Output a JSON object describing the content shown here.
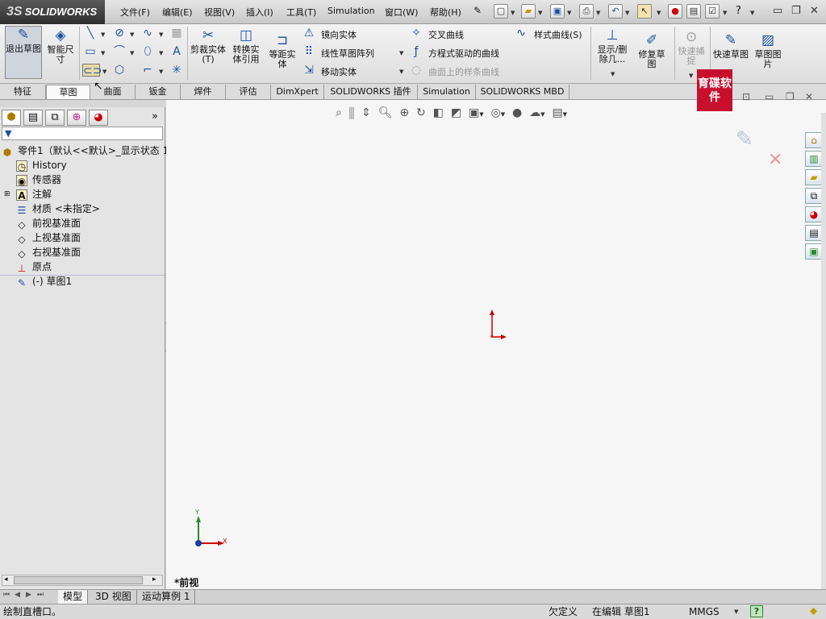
{
  "app": {
    "brand": "SOLIDWORKS"
  },
  "menu": [
    "文件(F)",
    "编辑(E)",
    "视图(V)",
    "插入(I)",
    "工具(T)",
    "Simulation",
    "窗口(W)",
    "帮助(H)"
  ],
  "ribbon": {
    "exit_sketch": "退出草图",
    "smart_dim": "智能尺寸",
    "trim": "剪裁实体(T)",
    "convert": "转换实体引用",
    "offset": "等距实体",
    "mirror": "镜向实体",
    "linear_pattern": "线性草图阵列",
    "move": "移动实体",
    "intersect": "交叉曲线",
    "equation_curve": "方程式驱动的曲线",
    "curve_on_surface": "曲面上的样条曲线",
    "style_spline": "样式曲线(S)",
    "display_delete": "显示/删除几...",
    "repair": "修复草图",
    "quick_snap": "快速捕捉",
    "rapid_sketch": "快速草图",
    "sketch_picture": "草图图片"
  },
  "tabs": [
    "特征",
    "草图",
    "曲面",
    "钣金",
    "焊件",
    "评估",
    "DimXpert",
    "SOLIDWORKS 插件",
    "Simulation",
    "SOLIDWORKS MBD"
  ],
  "active_tab": "草图",
  "tree": {
    "root": "零件1（默认<<默认>_显示状态 1",
    "items": [
      "History",
      "传感器",
      "注解",
      "材质 <未指定>",
      "前视基准面",
      "上视基准面",
      "右视基准面",
      "原点",
      "(-) 草图1"
    ]
  },
  "watermark": "育碟软件",
  "viewport": {
    "view_label": "*前视",
    "axis_y": "Y",
    "axis_x": "X"
  },
  "bottom_tabs": [
    "模型",
    "3D 视图",
    "运动算例 1"
  ],
  "status": {
    "hint": "绘制直槽口。",
    "state": "欠定义",
    "editing": "在编辑 草图1",
    "units": "MMGS",
    "help": "?"
  }
}
